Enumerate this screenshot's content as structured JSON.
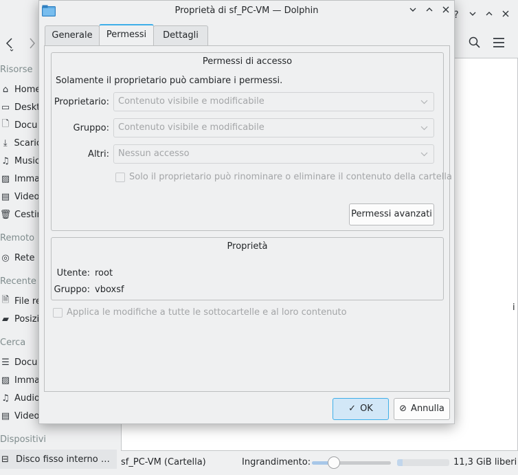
{
  "background": {
    "sidebar": {
      "sections": [
        {
          "title": "Risorse",
          "items": [
            "Home",
            "Deskt",
            "Docu",
            "Scaric",
            "Music",
            "Imma",
            "Video",
            "Cestin"
          ]
        },
        {
          "title": "Remoto",
          "items": [
            "Rete"
          ]
        },
        {
          "title": "Recente",
          "items": [
            "File re",
            "Posizi"
          ]
        },
        {
          "title": "Cerca",
          "items": [
            "Docu",
            "Imma",
            "Audio",
            "Video"
          ]
        },
        {
          "title": "Dispositivi",
          "items": [
            "Disco fisso interno da..."
          ]
        }
      ]
    },
    "statusbar": {
      "selection": "sf_PC-VM (Cartella)",
      "zoom_label": "Ingrandimento:",
      "zoom_level": 0.28,
      "used_space_fraction": 0.1,
      "free_space": "11,3 GiB liberi"
    },
    "right_edge_glyph": "i"
  },
  "dialog": {
    "title": "Proprietà di sf_PC-VM — Dolphin",
    "tabs": [
      "Generale",
      "Permessi",
      "Dettagli"
    ],
    "active_tab": "Permessi",
    "access": {
      "title": "Permessi di accesso",
      "notice": "Solamente il proprietario può cambiare i permessi.",
      "owner_label": "Proprietario:",
      "owner_value": "Contenuto visibile e modificabile",
      "group_label": "Gruppo:",
      "group_value": "Contenuto visibile e modificabile",
      "others_label": "Altri:",
      "others_value": "Nessun accesso",
      "sticky_label": "Solo il proprietario può rinominare o eliminare il contenuto della cartella",
      "advanced_button": "Permessi avanzati"
    },
    "ownership": {
      "title": "Proprietà",
      "user_label": "Utente:",
      "user_value": "root",
      "group_label": "Gruppo:",
      "group_value": "vboxsf"
    },
    "recursive_label": "Applica le modifiche a tutte le sottocartelle e al loro contenuto",
    "ok_button": "OK",
    "cancel_button": "Annulla"
  },
  "colors": {
    "accent": "#3daee9",
    "window_bg": "#eff0f1",
    "disabled_text": "#a3a5a7"
  }
}
